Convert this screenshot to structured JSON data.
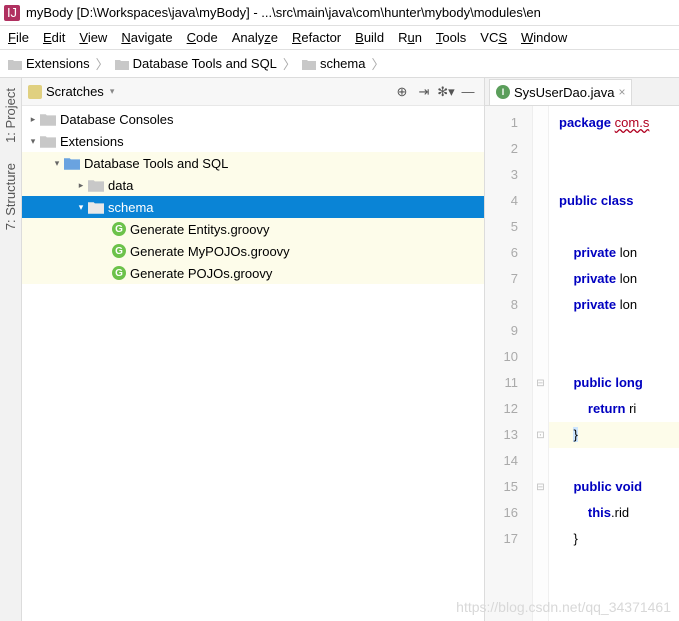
{
  "window": {
    "title": "myBody [D:\\Workspaces\\java\\myBody] - ...\\src\\main\\java\\com\\hunter\\mybody\\modules\\en"
  },
  "menu": {
    "items": [
      {
        "label": "File",
        "mn": "F"
      },
      {
        "label": "Edit",
        "mn": "E"
      },
      {
        "label": "View",
        "mn": "V"
      },
      {
        "label": "Navigate",
        "mn": "N"
      },
      {
        "label": "Code",
        "mn": "C"
      },
      {
        "label": "Analyze",
        "mn": ""
      },
      {
        "label": "Refactor",
        "mn": "R"
      },
      {
        "label": "Build",
        "mn": "B"
      },
      {
        "label": "Run",
        "mn": "u"
      },
      {
        "label": "Tools",
        "mn": "T"
      },
      {
        "label": "VCS",
        "mn": "S"
      },
      {
        "label": "Window",
        "mn": "W"
      }
    ]
  },
  "breadcrumb": {
    "items": [
      "Extensions",
      "Database Tools and SQL",
      "schema"
    ]
  },
  "left_tabs": {
    "project": "1: Project",
    "structure": "7: Structure"
  },
  "panel": {
    "scope": "Scratches"
  },
  "tree": {
    "n0": {
      "label": "Database Consoles"
    },
    "n1": {
      "label": "Extensions"
    },
    "n2": {
      "label": "Database Tools and SQL"
    },
    "n3": {
      "label": "data"
    },
    "n4": {
      "label": "schema"
    },
    "n5": {
      "label": "Generate Entitys.groovy"
    },
    "n6": {
      "label": "Generate MyPOJOs.groovy"
    },
    "n7": {
      "label": "Generate POJOs.groovy"
    }
  },
  "editor": {
    "tab_name": "SysUserDao.java",
    "lines": {
      "1": "package com.s",
      "2": "",
      "3": "",
      "4": "public class ",
      "5": "",
      "6": "    private lon",
      "7": "    private lon",
      "8": "    private lon",
      "9": "",
      "10": "",
      "11": "    public long",
      "12": "        return ri",
      "13": "    }",
      "14": "",
      "15": "    public void",
      "16": "        this.rid ",
      "17": "    }"
    },
    "gutter_numbers": [
      "1",
      "2",
      "3",
      "4",
      "5",
      "6",
      "7",
      "8",
      "9",
      "10",
      "11",
      "12",
      "13",
      "14",
      "15",
      "16",
      "17"
    ]
  },
  "watermark": "https://blog.csdn.net/qq_34371461"
}
